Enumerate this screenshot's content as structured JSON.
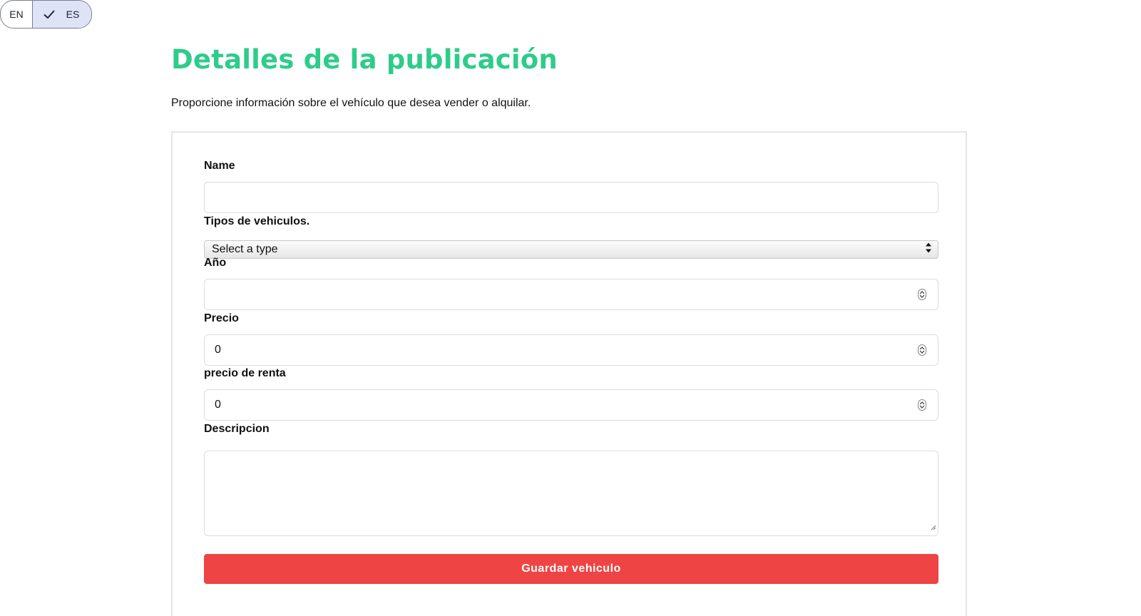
{
  "language_toggle": {
    "en_label": "EN",
    "es_label": "ES",
    "selected": "ES",
    "check_icon": "check-icon"
  },
  "header": {
    "title": "Detalles de la publicación",
    "subtitle": "Proporcione información sobre el vehículo que desea vender o alquilar."
  },
  "form": {
    "name": {
      "label": "Name",
      "value": ""
    },
    "vehicle_type": {
      "label": "Tipos de vehiculos.",
      "selected": "Select a type"
    },
    "year": {
      "label": "Año",
      "value": ""
    },
    "price": {
      "label": "Precio",
      "value": "0"
    },
    "rent_price": {
      "label": "precio de renta",
      "value": "0"
    },
    "description": {
      "label": "Descripcion",
      "value": ""
    },
    "submit_label": "Guardar vehiculo"
  },
  "colors": {
    "title": "#2ecc8a",
    "button": "#ef4444",
    "selected_lang_bg": "#dfe3f7"
  }
}
